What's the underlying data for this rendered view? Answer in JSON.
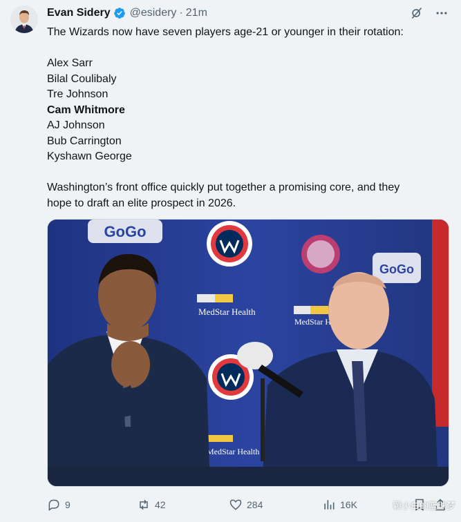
{
  "author": {
    "name": "Evan Sidery",
    "handle": "@esidery",
    "separator": "·",
    "time": "21m"
  },
  "tweet": {
    "intro": "The Wizards now have seven players age-21 or younger in their rotation:",
    "players": [
      "Alex Sarr",
      "Bilal Coulibaly",
      "Tre Johnson",
      "Cam Whitmore",
      "AJ Johnson",
      "Bub Carrington",
      "Kyshawn George"
    ],
    "highlighted_player": "Cam Whitmore",
    "outro_line1": "Washington’s front office quickly put together a promising core, and they",
    "outro_line2": "hope to draft an elite prospect in 2026."
  },
  "photo": {
    "backdrop_logos": [
      "GoGo",
      "MedStar Health"
    ]
  },
  "actions": {
    "replies": "9",
    "reposts": "42",
    "likes": "284",
    "views": "16K"
  },
  "watermark": "颗小白的篮球梦",
  "colors": {
    "verified": "#1d9bf0",
    "backdrop": "#253a86",
    "accent_red": "#d92b2b"
  },
  "icons": [
    "grok-icon",
    "more-icon",
    "reply-icon",
    "repost-icon",
    "like-icon",
    "views-icon",
    "bookmark-icon",
    "share-icon"
  ]
}
